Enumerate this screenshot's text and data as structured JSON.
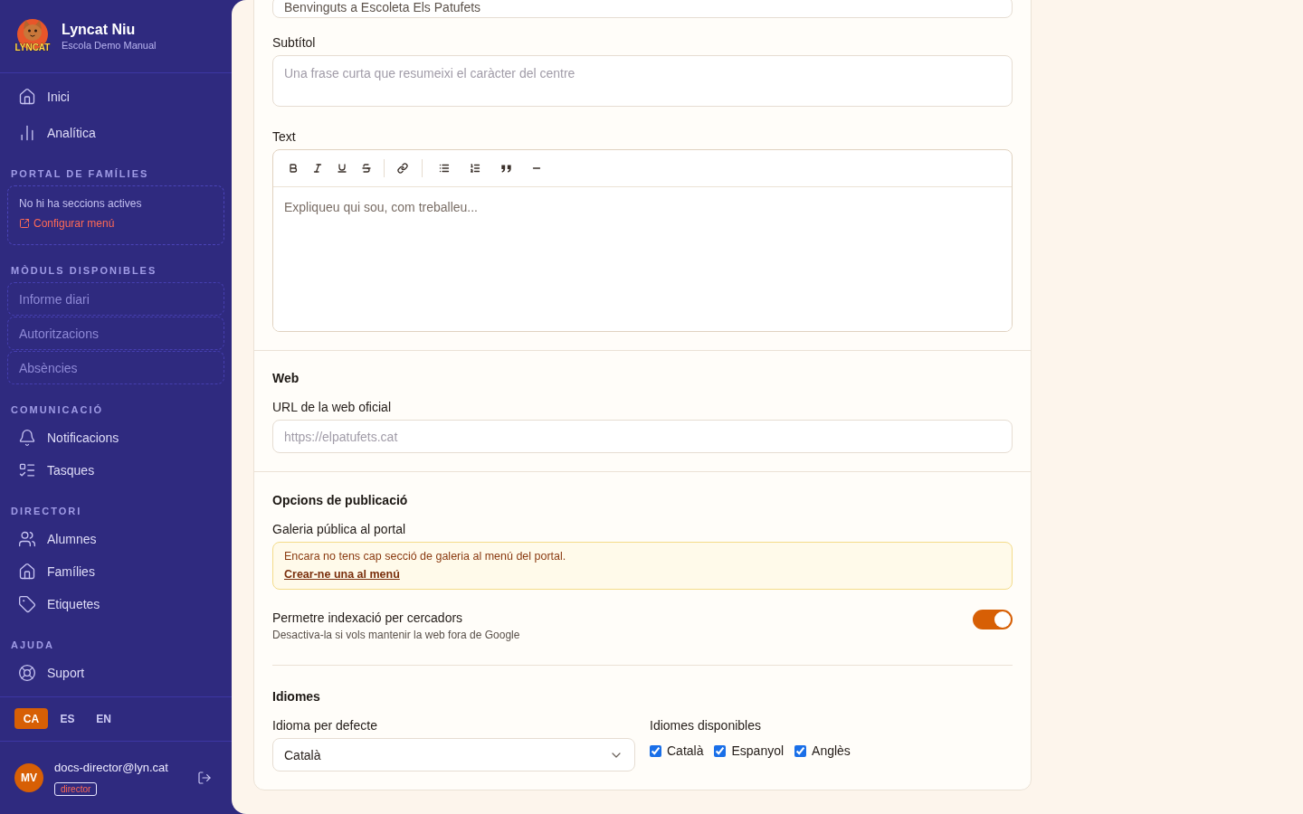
{
  "sidebar": {
    "brand": {
      "logo_text": "LYNCAT",
      "title": "Lyncat Niu",
      "subtitle": "Escola Demo Manual"
    },
    "nav": [
      {
        "label": "Inici",
        "selected": false
      },
      {
        "label": "Analítica",
        "selected": false
      }
    ],
    "sections": [
      {
        "kind": "notice",
        "title": "PORTAL DE FAMÍLIES",
        "message": "No hi ha seccions actives",
        "link": "Configurar menú"
      },
      {
        "kind": "modules",
        "title": "MÒDULS DISPONIBLES",
        "items": [
          "Informe diari",
          "Autoritzacions",
          "Absències"
        ]
      },
      {
        "kind": "nav",
        "title": "COMUNICACIÓ",
        "items": [
          {
            "label": "Notificacions",
            "selected": false
          },
          {
            "label": "Tasques",
            "selected": false
          }
        ]
      },
      {
        "kind": "nav",
        "title": "DIRECTORI",
        "items": [
          {
            "label": "Alumnes",
            "selected": false
          },
          {
            "label": "Famílies",
            "selected": false
          },
          {
            "label": "Etiquetes",
            "selected": false
          }
        ]
      },
      {
        "kind": "nav",
        "title": "AJUDA",
        "items": [
          {
            "label": "Suport",
            "selected": false
          }
        ]
      }
    ],
    "languages": [
      {
        "label": "CA",
        "selected": true
      },
      {
        "label": "ES",
        "selected": false
      },
      {
        "label": "EN",
        "selected": false
      }
    ],
    "user": {
      "initials": "MV",
      "email": "docs-director@lyn.cat",
      "role": "director"
    }
  },
  "form": {
    "content": {
      "title_field": {
        "value": "Benvinguts a Escoleta Els Patufets"
      },
      "subtitle": {
        "label": "Subtítol",
        "placeholder": "Una frase curta que resumeixi el caràcter del centre"
      },
      "text": {
        "label": "Text",
        "placeholder": "Expliqueu qui sou, com treballeu..."
      }
    },
    "web": {
      "title": "Web",
      "url": {
        "label": "URL de la web oficial",
        "placeholder": "https://elpatufets.cat"
      }
    },
    "publishing": {
      "title": "Opcions de publicació",
      "gallery": {
        "label": "Galeria pública al portal",
        "notice": "Encara no tens cap secció de galeria al menú del portal.",
        "link": "Crear-ne una al menú"
      },
      "indexing": {
        "label": "Permetre indexació per cercadors",
        "hint": "Desactiva-la si vols mantenir la web fora de Google",
        "on": true
      }
    },
    "languages": {
      "title": "Idiomes",
      "default_language": {
        "label": "Idioma per defecte",
        "value": "Català"
      },
      "available": {
        "label": "Idiomes disponibles",
        "options": [
          {
            "label": "Català",
            "checked": true
          },
          {
            "label": "Espanyol",
            "checked": true
          },
          {
            "label": "Anglès",
            "checked": true
          }
        ]
      }
    }
  }
}
